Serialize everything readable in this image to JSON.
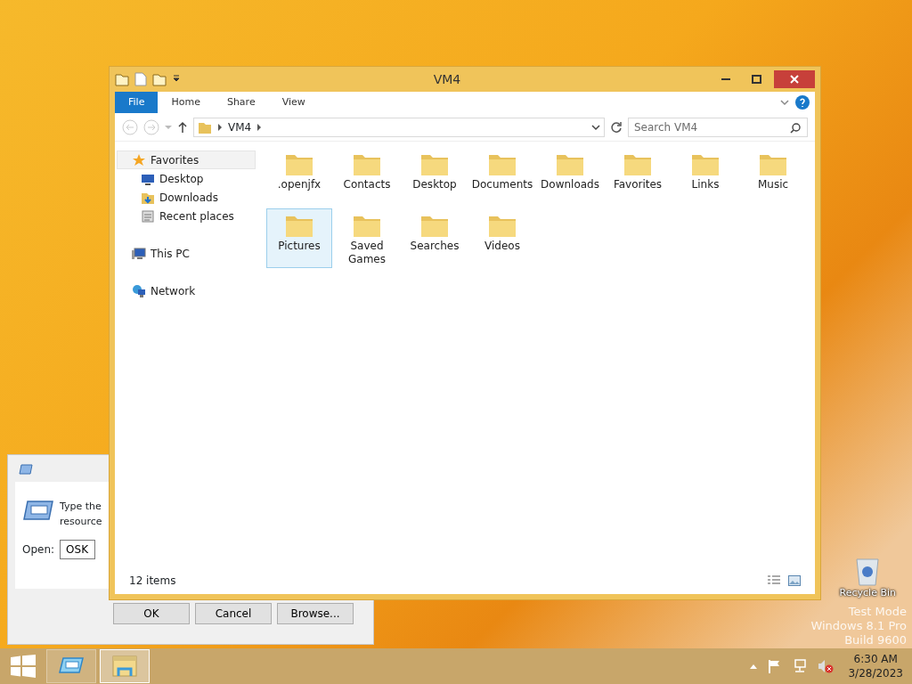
{
  "explorer": {
    "title": "VM4",
    "ribbon_tabs": [
      {
        "label": "File",
        "kind": "file"
      },
      {
        "label": "Home",
        "kind": "tab"
      },
      {
        "label": "Share",
        "kind": "tab"
      },
      {
        "label": "View",
        "kind": "tab"
      }
    ],
    "address": {
      "path": [
        "VM4"
      ]
    },
    "search": {
      "placeholder": "Search VM4"
    },
    "nav": [
      {
        "label": "Favorites",
        "kind": "star",
        "selected": true,
        "children": [
          {
            "label": "Desktop",
            "kind": "desktop",
            "selected": false
          },
          {
            "label": "Downloads",
            "kind": "download",
            "selected": false
          },
          {
            "label": "Recent places",
            "kind": "recent",
            "selected": false
          }
        ]
      },
      {
        "label": "This PC",
        "kind": "pc",
        "selected": false
      },
      {
        "label": "Network",
        "kind": "network",
        "selected": false
      }
    ],
    "items": [
      {
        "label": ".openjfx",
        "selected": false
      },
      {
        "label": "Contacts",
        "selected": false
      },
      {
        "label": "Desktop",
        "selected": false
      },
      {
        "label": "Documents",
        "selected": false
      },
      {
        "label": "Downloads",
        "selected": false
      },
      {
        "label": "Favorites",
        "selected": false
      },
      {
        "label": "Links",
        "selected": false
      },
      {
        "label": "Music",
        "selected": false
      },
      {
        "label": "Pictures",
        "selected": true
      },
      {
        "label": "Saved Games",
        "selected": false
      },
      {
        "label": "Searches",
        "selected": false
      },
      {
        "label": "Videos",
        "selected": false
      }
    ],
    "status": "12 items"
  },
  "run_dialog": {
    "lines": [
      "Type the",
      "resource"
    ],
    "open_label": "Open:",
    "value": "OSK",
    "buttons": [
      "OK",
      "Cancel",
      "Browse..."
    ]
  },
  "desktop": {
    "recycle_bin": "Recycle Bin",
    "watermark": [
      "Test Mode",
      "Windows 8.1 Pro",
      "Build 9600"
    ]
  },
  "taskbar": {
    "apps": [
      {
        "kind": "run",
        "selected": false
      },
      {
        "kind": "explorer",
        "selected": true
      }
    ],
    "time": "6:30 AM",
    "date": "3/28/2023"
  }
}
